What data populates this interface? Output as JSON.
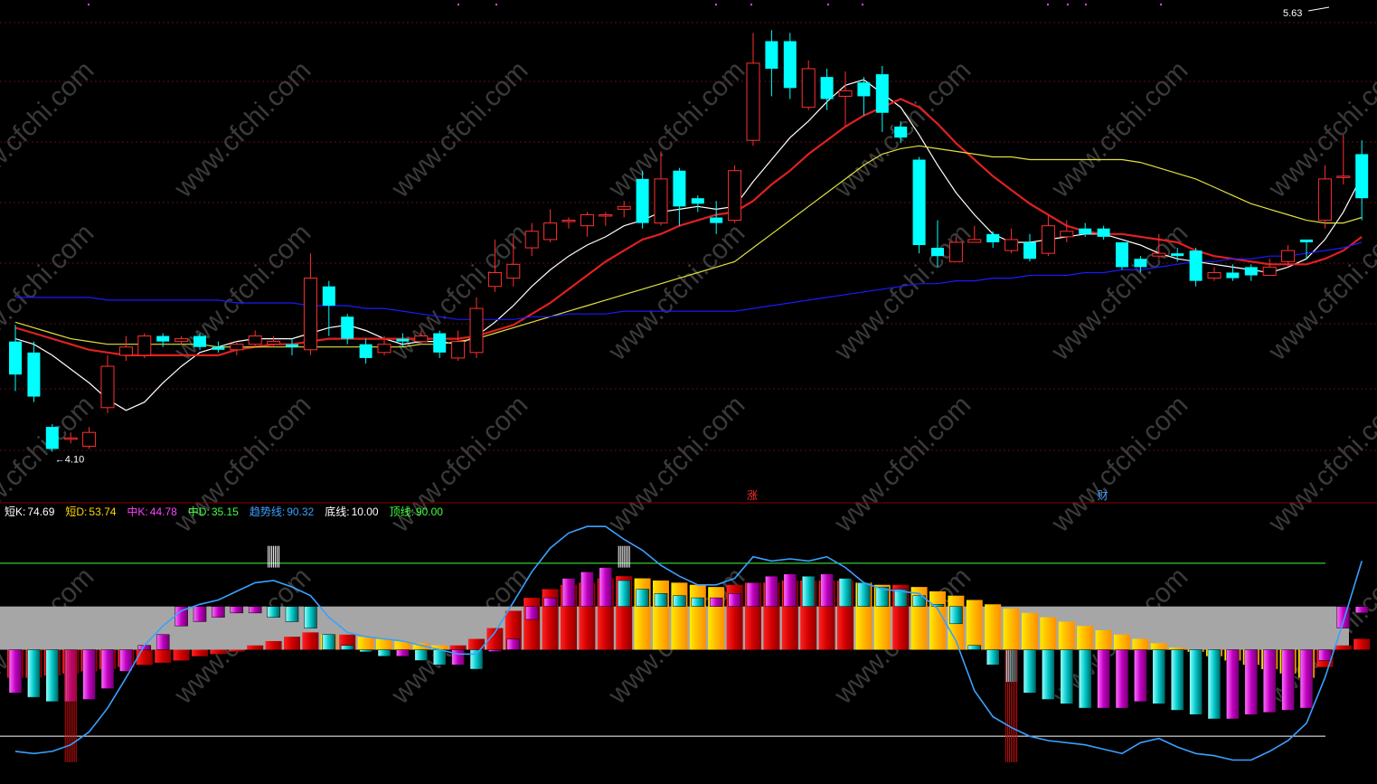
{
  "chart_data": [
    {
      "type": "candlestick",
      "title": "",
      "price_high_label": "5.63",
      "price_low_label": "←4.10",
      "markers": [
        {
          "text": "涨",
          "color": "#ff3030",
          "bar_index": 40
        },
        {
          "text": "财",
          "color": "#4aa3ff",
          "bar_index": 59
        }
      ],
      "price_range": [
        3.98,
        5.68
      ],
      "candles": [
        [
          4.48,
          4.36,
          4.54,
          4.3
        ],
        [
          4.44,
          4.28,
          4.48,
          4.26
        ],
        [
          4.17,
          4.09,
          4.18,
          4.08
        ],
        [
          4.13,
          4.13,
          4.15,
          4.11
        ],
        [
          4.1,
          4.15,
          4.17,
          4.09
        ],
        [
          4.24,
          4.39,
          4.43,
          4.22
        ],
        [
          4.43,
          4.46,
          4.5,
          4.41
        ],
        [
          4.43,
          4.5,
          4.51,
          4.42
        ],
        [
          4.5,
          4.48,
          4.51,
          4.46
        ],
        [
          4.48,
          4.49,
          4.5,
          4.47
        ],
        [
          4.5,
          4.46,
          4.51,
          4.45
        ],
        [
          4.46,
          4.45,
          4.48,
          4.44
        ],
        [
          4.45,
          4.47,
          4.48,
          4.43
        ],
        [
          4.47,
          4.5,
          4.52,
          4.46
        ],
        [
          4.47,
          4.48,
          4.5,
          4.46
        ],
        [
          4.47,
          4.46,
          4.49,
          4.43
        ],
        [
          4.45,
          4.71,
          4.8,
          4.43
        ],
        [
          4.68,
          4.61,
          4.7,
          4.5
        ],
        [
          4.57,
          4.49,
          4.58,
          4.47
        ],
        [
          4.47,
          4.42,
          4.49,
          4.4
        ],
        [
          4.44,
          4.47,
          4.5,
          4.43
        ],
        [
          4.49,
          4.48,
          4.51,
          4.46
        ],
        [
          4.48,
          4.5,
          4.52,
          4.47
        ],
        [
          4.51,
          4.44,
          4.52,
          4.42
        ],
        [
          4.42,
          4.48,
          4.52,
          4.41
        ],
        [
          4.44,
          4.6,
          4.64,
          4.42
        ],
        [
          4.68,
          4.73,
          4.85,
          4.66
        ],
        [
          4.71,
          4.76,
          4.86,
          4.68
        ],
        [
          4.82,
          4.88,
          4.91,
          4.79
        ],
        [
          4.85,
          4.91,
          4.96,
          4.84
        ],
        [
          4.92,
          4.92,
          4.93,
          4.89
        ],
        [
          4.9,
          4.94,
          4.95,
          4.86
        ],
        [
          4.94,
          4.94,
          4.95,
          4.9
        ],
        [
          4.96,
          4.97,
          4.99,
          4.93
        ],
        [
          5.07,
          4.91,
          5.1,
          4.89
        ],
        [
          4.91,
          5.07,
          5.17,
          4.9
        ],
        [
          5.1,
          4.97,
          5.11,
          4.9
        ],
        [
          5.0,
          4.98,
          5.01,
          4.95
        ],
        [
          4.93,
          4.91,
          4.99,
          4.87
        ],
        [
          4.92,
          5.1,
          5.12,
          4.91
        ],
        [
          5.21,
          5.49,
          5.6,
          5.19
        ],
        [
          5.57,
          5.47,
          5.61,
          5.37
        ],
        [
          5.57,
          5.4,
          5.6,
          5.36
        ],
        [
          5.33,
          5.47,
          5.5,
          5.32
        ],
        [
          5.44,
          5.36,
          5.47,
          5.32
        ],
        [
          5.37,
          5.39,
          5.46,
          5.26
        ],
        [
          5.42,
          5.37,
          5.44,
          5.3
        ],
        [
          5.45,
          5.31,
          5.48,
          5.24
        ],
        [
          5.26,
          5.22,
          5.28,
          5.2
        ],
        [
          5.14,
          4.83,
          5.15,
          4.8
        ],
        [
          4.82,
          4.79,
          4.92,
          4.75
        ],
        [
          4.77,
          4.84,
          4.86,
          4.77
        ],
        [
          4.84,
          4.85,
          4.9,
          4.84
        ],
        [
          4.87,
          4.84,
          4.88,
          4.82
        ],
        [
          4.81,
          4.85,
          4.89,
          4.8
        ],
        [
          4.84,
          4.78,
          4.87,
          4.77
        ],
        [
          4.8,
          4.9,
          4.94,
          4.79
        ],
        [
          4.86,
          4.88,
          4.92,
          4.84
        ],
        [
          4.89,
          4.87,
          4.91,
          4.86
        ],
        [
          4.89,
          4.86,
          4.9,
          4.85
        ],
        [
          4.84,
          4.75,
          4.84,
          4.74
        ],
        [
          4.78,
          4.75,
          4.79,
          4.73
        ],
        [
          4.79,
          4.8,
          4.87,
          4.78
        ],
        [
          4.8,
          4.79,
          4.82,
          4.77
        ],
        [
          4.81,
          4.7,
          4.82,
          4.68
        ],
        [
          4.71,
          4.73,
          4.75,
          4.7
        ],
        [
          4.73,
          4.71,
          4.76,
          4.7
        ],
        [
          4.75,
          4.72,
          4.76,
          4.7
        ],
        [
          4.72,
          4.75,
          4.78,
          4.72
        ],
        [
          4.77,
          4.81,
          4.83,
          4.75
        ],
        [
          4.85,
          4.84,
          4.85,
          4.78
        ],
        [
          4.92,
          5.07,
          5.12,
          4.89
        ],
        [
          5.08,
          5.08,
          5.23,
          5.05
        ],
        [
          5.16,
          5.0,
          5.21,
          4.92
        ]
      ],
      "ma_lines": [
        {
          "color": "#ffffff",
          "values": [
            4.49,
            4.47,
            4.43,
            4.38,
            4.33,
            4.27,
            4.23,
            4.26,
            4.33,
            4.39,
            4.44,
            4.46,
            4.48,
            4.49,
            4.49,
            4.49,
            4.51,
            4.53,
            4.54,
            4.52,
            4.49,
            4.47,
            4.48,
            4.48,
            4.47,
            4.5,
            4.55,
            4.61,
            4.68,
            4.74,
            4.79,
            4.83,
            4.86,
            4.9,
            4.92,
            4.95,
            4.96,
            4.97,
            4.96,
            4.97,
            5.06,
            5.14,
            5.22,
            5.28,
            5.35,
            5.41,
            5.43,
            5.38,
            5.33,
            5.23,
            5.12,
            5.02,
            4.94,
            4.87,
            4.84,
            4.84,
            4.85,
            4.86,
            4.87,
            4.87,
            4.85,
            4.83,
            4.8,
            4.78,
            4.77,
            4.76,
            4.75,
            4.74,
            4.73,
            4.75,
            4.78,
            4.85,
            4.95,
            5.08
          ]
        },
        {
          "color": "#e02020",
          "values": [
            4.53,
            4.51,
            4.49,
            4.47,
            4.45,
            4.44,
            4.43,
            4.43,
            4.43,
            4.43,
            4.43,
            4.43,
            4.45,
            4.46,
            4.47,
            4.47,
            4.48,
            4.49,
            4.49,
            4.49,
            4.49,
            4.49,
            4.49,
            4.49,
            4.49,
            4.5,
            4.52,
            4.54,
            4.58,
            4.62,
            4.67,
            4.72,
            4.77,
            4.81,
            4.85,
            4.87,
            4.9,
            4.92,
            4.94,
            4.95,
            4.99,
            5.05,
            5.1,
            5.16,
            5.21,
            5.26,
            5.3,
            5.33,
            5.36,
            5.33,
            5.27,
            5.2,
            5.14,
            5.08,
            5.03,
            4.98,
            4.94,
            4.9,
            4.88,
            4.87,
            4.87,
            4.86,
            4.85,
            4.84,
            4.81,
            4.79,
            4.78,
            4.77,
            4.76,
            4.76,
            4.76,
            4.78,
            4.81,
            4.86
          ]
        },
        {
          "color": "#e0e040",
          "values": [
            4.55,
            4.53,
            4.51,
            4.49,
            4.48,
            4.47,
            4.47,
            4.47,
            4.47,
            4.47,
            4.47,
            4.46,
            4.46,
            4.46,
            4.46,
            4.46,
            4.46,
            4.46,
            4.46,
            4.46,
            4.46,
            4.46,
            4.47,
            4.47,
            4.48,
            4.49,
            4.51,
            4.53,
            4.55,
            4.57,
            4.59,
            4.61,
            4.63,
            4.65,
            4.67,
            4.69,
            4.71,
            4.73,
            4.75,
            4.77,
            4.82,
            4.87,
            4.92,
            4.97,
            5.02,
            5.07,
            5.12,
            5.16,
            5.18,
            5.19,
            5.18,
            5.17,
            5.16,
            5.15,
            5.15,
            5.14,
            5.14,
            5.14,
            5.14,
            5.14,
            5.14,
            5.13,
            5.11,
            5.09,
            5.07,
            5.04,
            5.01,
            4.98,
            4.96,
            4.94,
            4.92,
            4.91,
            4.91,
            4.93
          ]
        },
        {
          "color": "#1a1aff",
          "values": [
            4.64,
            4.64,
            4.64,
            4.64,
            4.64,
            4.63,
            4.63,
            4.63,
            4.63,
            4.63,
            4.63,
            4.63,
            4.62,
            4.62,
            4.62,
            4.62,
            4.61,
            4.61,
            4.61,
            4.6,
            4.6,
            4.59,
            4.58,
            4.57,
            4.56,
            4.56,
            4.56,
            4.56,
            4.57,
            4.57,
            4.58,
            4.58,
            4.58,
            4.59,
            4.59,
            4.59,
            4.59,
            4.59,
            4.59,
            4.59,
            4.6,
            4.61,
            4.62,
            4.63,
            4.64,
            4.65,
            4.66,
            4.67,
            4.68,
            4.69,
            4.69,
            4.7,
            4.7,
            4.71,
            4.71,
            4.72,
            4.72,
            4.72,
            4.73,
            4.73,
            4.74,
            4.74,
            4.75,
            4.76,
            4.77,
            4.77,
            4.78,
            4.78,
            4.79,
            4.79,
            4.8,
            4.81,
            4.82,
            4.84
          ]
        }
      ]
    },
    {
      "type": "bar",
      "title": "",
      "legend": [
        {
          "label": "短K:",
          "value": "74.69",
          "color": "#ffffff"
        },
        {
          "label": "短D:",
          "value": "53.74",
          "color": "#ffd700"
        },
        {
          "label": "中K:",
          "value": "44.78",
          "color": "#ff40ff"
        },
        {
          "label": "中D:",
          "value": "35.15",
          "color": "#40ff40"
        },
        {
          "label": "趋势线:",
          "value": "90.32",
          "color": "#3aa0ff"
        },
        {
          "label": "底线:",
          "value": "10.00",
          "color": "#ffffff"
        },
        {
          "label": "顶线:",
          "value": "90.00",
          "color": "#40ff40"
        }
      ],
      "y_range": [
        -10,
        110
      ],
      "bottom_line": 10.0,
      "top_line": 90.0,
      "band": [
        50,
        70
      ],
      "trend_line": [
        3,
        2,
        3,
        6,
        12,
        23,
        37,
        52,
        61,
        68,
        71,
        73,
        77,
        81,
        82,
        79,
        75,
        65,
        58,
        56,
        55,
        54,
        52,
        50,
        48,
        48,
        58,
        72,
        86,
        97,
        104,
        107,
        107,
        101,
        96,
        89,
        84,
        80,
        80,
        83,
        93,
        91,
        92,
        91,
        93,
        88,
        81,
        78,
        77,
        76,
        69,
        54,
        31,
        19,
        14,
        10,
        8,
        7,
        6,
        4,
        2,
        7,
        9,
        5,
        2,
        1,
        -1,
        -1,
        3,
        8,
        16,
        37,
        63,
        91
      ],
      "short_k": [
        30,
        28,
        26,
        26,
        27,
        32,
        40,
        52,
        57,
        61,
        63,
        65,
        67,
        67,
        65,
        63,
        60,
        57,
        52,
        49,
        47,
        47,
        45,
        43,
        43,
        41,
        50,
        55,
        64,
        74,
        83,
        86,
        88,
        82,
        78,
        76,
        75,
        74,
        74,
        76,
        81,
        84,
        85,
        84,
        85,
        83,
        81,
        79,
        78,
        75,
        71,
        62,
        52,
        43,
        35,
        30,
        27,
        25,
        23,
        23,
        23,
        26,
        25,
        22,
        20,
        18,
        18,
        20,
        21,
        22,
        23,
        45,
        60,
        67
      ],
      "mid_d": [
        37,
        37,
        38,
        39,
        40,
        41,
        42,
        43,
        44,
        45,
        47,
        48,
        50,
        52,
        54,
        56,
        58,
        57,
        57,
        56,
        55,
        54,
        53,
        52,
        52,
        55,
        60,
        68,
        74,
        78,
        80,
        81,
        83,
        84,
        83,
        82,
        81,
        80,
        79,
        80,
        81,
        81,
        82,
        82,
        82,
        82,
        81,
        80,
        80,
        79,
        77,
        75,
        73,
        71,
        69,
        67,
        65,
        63,
        61,
        59,
        57,
        55,
        53,
        51,
        49,
        47,
        45,
        43,
        41,
        39,
        37,
        42,
        52,
        55
      ]
    }
  ]
}
